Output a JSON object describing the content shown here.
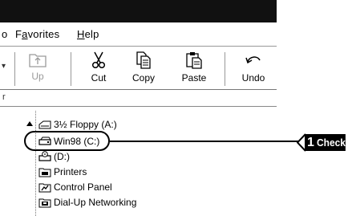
{
  "menubar": {
    "edge_fragment": "o",
    "items": [
      {
        "label": "Favorites",
        "accel_index": 1
      },
      {
        "label": "Help",
        "accel_index": 0
      }
    ]
  },
  "toolbar": {
    "edge_fragment": "▾",
    "buttons": [
      {
        "label": "Up",
        "icon": "folder-up-icon",
        "enabled": false
      },
      {
        "label": "Cut",
        "icon": "scissors-icon",
        "enabled": true
      },
      {
        "label": "Copy",
        "icon": "copy-icon",
        "enabled": true
      },
      {
        "label": "Paste",
        "icon": "paste-icon",
        "enabled": true
      },
      {
        "label": "Undo",
        "icon": "undo-icon",
        "enabled": true
      }
    ]
  },
  "addressbar": {
    "edge_fragment": "r"
  },
  "tree": {
    "items": [
      {
        "label": "3½ Floppy (A:)",
        "icon": "floppy-drive-icon"
      },
      {
        "label": "Win98 (C:)",
        "icon": "hard-drive-icon",
        "selected": true
      },
      {
        "label": "(D:)",
        "icon": "cd-drive-icon"
      },
      {
        "label": "Printers",
        "icon": "printers-folder-icon"
      },
      {
        "label": "Control Panel",
        "icon": "control-panel-icon"
      },
      {
        "label": "Dial-Up Networking",
        "icon": "dialup-networking-icon"
      }
    ]
  },
  "callout": {
    "step_number": "1",
    "text": "Check"
  },
  "colors": {
    "titlebar": "#111111",
    "disabled_text": "#9a9a9a",
    "callout": "#000000"
  }
}
